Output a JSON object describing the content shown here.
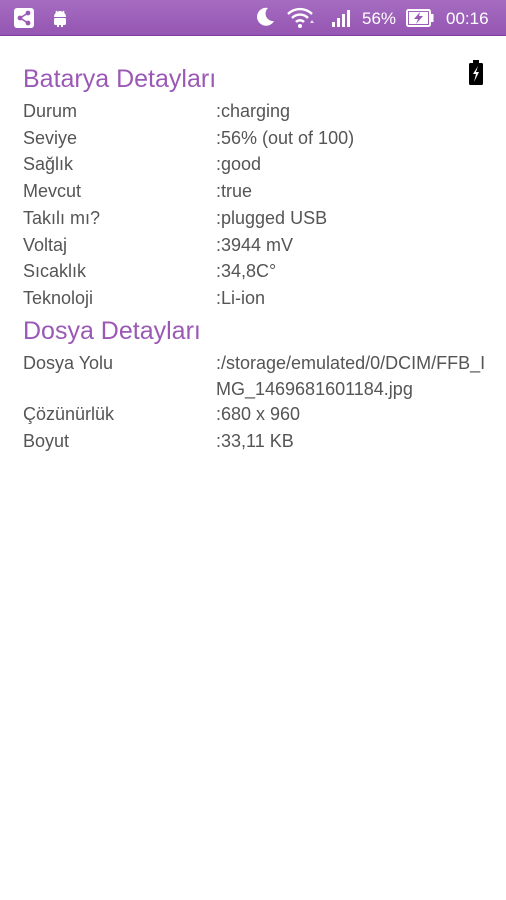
{
  "status_bar": {
    "battery_percent": "56%",
    "time": "00:16",
    "left_icons": [
      "share-icon",
      "android-icon"
    ],
    "right_icons": [
      "moon-icon",
      "wifi-icon",
      "signal-icon",
      "battery-charging-icon"
    ],
    "background_color": "#9b59b6"
  },
  "battery_section": {
    "title": "Batarya Detayları",
    "corner_icon": "battery-charging-icon",
    "rows": [
      {
        "label": "Durum",
        "value": ":charging"
      },
      {
        "label": "Seviye",
        "value": ":56% (out of 100)"
      },
      {
        "label": "Sağlık",
        "value": ":good"
      },
      {
        "label": "Mevcut",
        "value": ":true"
      },
      {
        "label": "Takılı mı?",
        "value": ":plugged USB"
      },
      {
        "label": "Voltaj",
        "value": ":3944 mV"
      },
      {
        "label": "Sıcaklık",
        "value": ":34,8C°"
      },
      {
        "label": "Teknoloji",
        "value": ":Li-ion"
      }
    ]
  },
  "file_section": {
    "title": "Dosya Detayları",
    "rows": [
      {
        "label": "Dosya Yolu",
        "value": ":/storage/emulated/0/DCIM/FFB_IMG_1469681601184.jpg"
      },
      {
        "label": "Çözünürlük",
        "value": ":680 x 960"
      },
      {
        "label": "Boyut",
        "value": ":33,11 KB"
      }
    ]
  },
  "colors": {
    "accent": "#9b59b6",
    "text": "#555555",
    "background": "#ffffff"
  }
}
